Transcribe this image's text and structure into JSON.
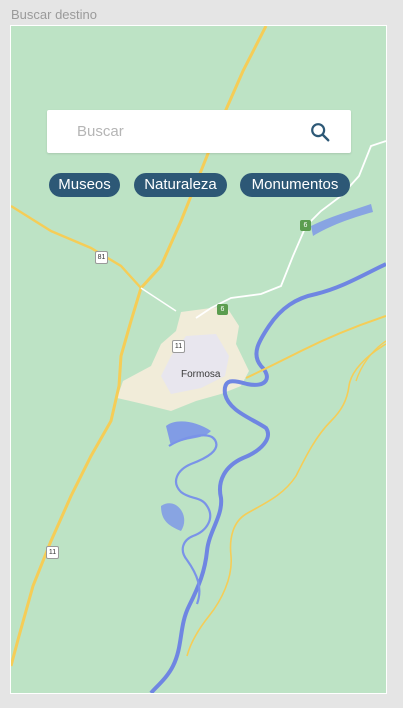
{
  "frame": {
    "title": "Buscar destino"
  },
  "search": {
    "placeholder": "Buscar",
    "value": "",
    "icon": "search-icon"
  },
  "chips": [
    {
      "label": "Museos"
    },
    {
      "label": "Naturaleza"
    },
    {
      "label": "Monumentos"
    }
  ],
  "map": {
    "city": "Formosa",
    "route_shields": [
      "81",
      "11",
      "11",
      "6",
      "6"
    ],
    "colors": {
      "land": "#bde3c5",
      "water": "#7a93e8",
      "highway": "#f5cd57",
      "urban": "#f1ecd9",
      "chip": "#2d5876"
    }
  }
}
